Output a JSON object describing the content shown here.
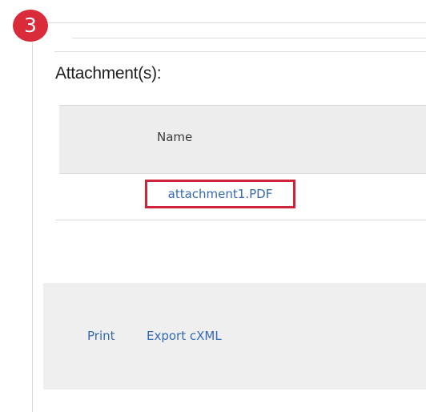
{
  "step_badge": "3",
  "section": {
    "title": "Attachment(s):"
  },
  "attachments_table": {
    "columns": [
      "Name"
    ],
    "rows": [
      {
        "name": "attachment1.PDF"
      }
    ]
  },
  "highlight_color": "#d0243a",
  "link_color": "#3569b4",
  "footer": {
    "print_label": "Print",
    "export_label": "Export cXML"
  }
}
